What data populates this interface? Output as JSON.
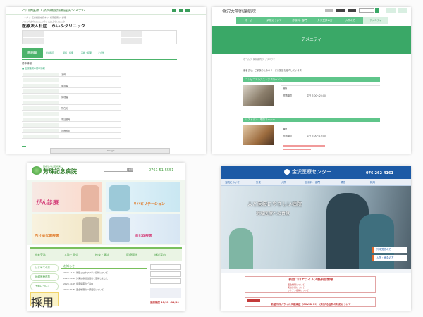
{
  "colors": {
    "green": "#4cb36b",
    "teal": "#3aa867",
    "mint": "#5fc58a",
    "blue": "#1c5aa6",
    "red": "#c43a3a",
    "orange": "#e46a2b"
  },
  "p1": {
    "system_title": "石川県医療・薬局機能情報提供システム",
    "breadcrumb": "トップ ＞ 医療機関を探す ＞ 検索結果 ＞ 詳細",
    "clinic_kana": "イリョウホウジンシャダン らいふクリニック",
    "clinic_name": "医療法人社団　らいふクリニック",
    "tab_active": "基本情報",
    "tabs": [
      "診療科目",
      "施設・設備",
      "実績・結果",
      "その他"
    ],
    "section": "基本情報",
    "sub": "■ 医療機関の基本情報",
    "rows": [
      "名称",
      "開設者",
      "管理者",
      "所在地",
      "電話番号",
      "診療科目"
    ],
    "map_label": "Google"
  },
  "p2": {
    "logo": "金沢大学附属病院",
    "nav": [
      "ホーム",
      "病院について",
      "診療科・部門",
      "外来受診の方",
      "入院の方",
      "アメニティ"
    ],
    "banner": "アメニティ",
    "breadcrumb": "ホーム ＞ 病院案内 ＞ アメニティ",
    "intro": "患者さん、ご家族のためのサービス施設を紹介しています。",
    "shop1": "コンビニエンスストア「ローソン」",
    "shop2": "レストラン・喫茶コーナー",
    "label_place": "場所",
    "label_hours": "営業時間",
    "hours1": "平日 7:00～20:00",
    "hours2": "平日 7:00～19:00"
  },
  "p3": {
    "logo": "芳珠記念病院",
    "sub_logo": "医療法人社団 和楽仁",
    "phone": "0761-51-5551",
    "search_placeholder": "検索",
    "hero": [
      "がん診療",
      "リハビリテーション",
      "内分泌代謝疾患",
      "消化器疾患"
    ],
    "menu": [
      "外来受診",
      "入院・面会",
      "検査・健診",
      "医療関係",
      "施設案内"
    ],
    "side": [
      "はじめての方",
      "地域医療連携",
      "予約について",
      "採用情報"
    ],
    "news_title": "お知らせ",
    "news": [
      "2023.11.01 新型コロナワクチン接種について",
      "2023.10.20 外来診療担当医表を更新しました",
      "2023.10.05 健康講座のご案内",
      "2023.09.30 面会制限の一部緩和について"
    ],
    "event": "健康講座 11/01～11/30"
  },
  "p4": {
    "logo": "金沢医療センター",
    "phone": "076-262-4161",
    "nav": [
      "当院について",
      "外来",
      "入院",
      "診療科・部門",
      "健診",
      "採用"
    ],
    "hero_title": "人と医療にやさしい病院",
    "sub_title": "地域医療への貢献",
    "btn1": "外来受診の方",
    "btn2": "入院・面会の方",
    "notice_title": "新型コロナウイルス感染症情報",
    "notice_lines": [
      "面会制限について",
      "発熱外来について",
      "ワクチン接種について"
    ],
    "bottom": "新型コロナウイルス感染症（COVID-19）に対する当院の対応について"
  }
}
